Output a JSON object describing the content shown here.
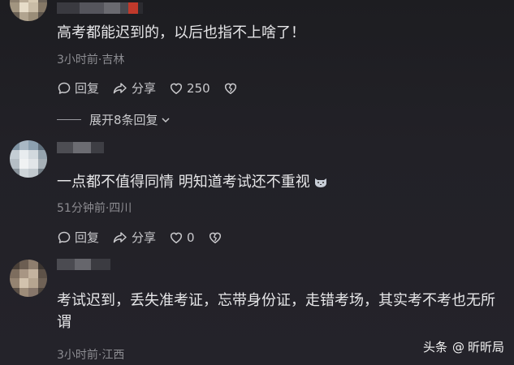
{
  "comments": [
    {
      "text": "高考都能迟到的，以后也指不上啥了！",
      "meta": "3小时前·吉林",
      "reply_label": "回复",
      "share_label": "分享",
      "like_count": "250",
      "replies_toggle": "展开8条回复"
    },
    {
      "text": "一点都不值得同情  明知道考试还不重视",
      "meta": "51分钟前·四川",
      "reply_label": "回复",
      "share_label": "分享",
      "like_count": "0"
    },
    {
      "text": "考试迟到，丢失准考证，忘带身份证，走错考场，其实考不考也无所谓",
      "meta": "3小时前·江西"
    }
  ],
  "watermark": {
    "brand": "头条",
    "account": "昕昕局"
  },
  "icons": {
    "reply": "comment-bubble-icon",
    "share": "share-arrow-icon",
    "like": "heart-icon",
    "dislike": "broken-heart-icon",
    "expand": "chevron-down-icon",
    "emoji": "cat-face-icon"
  }
}
